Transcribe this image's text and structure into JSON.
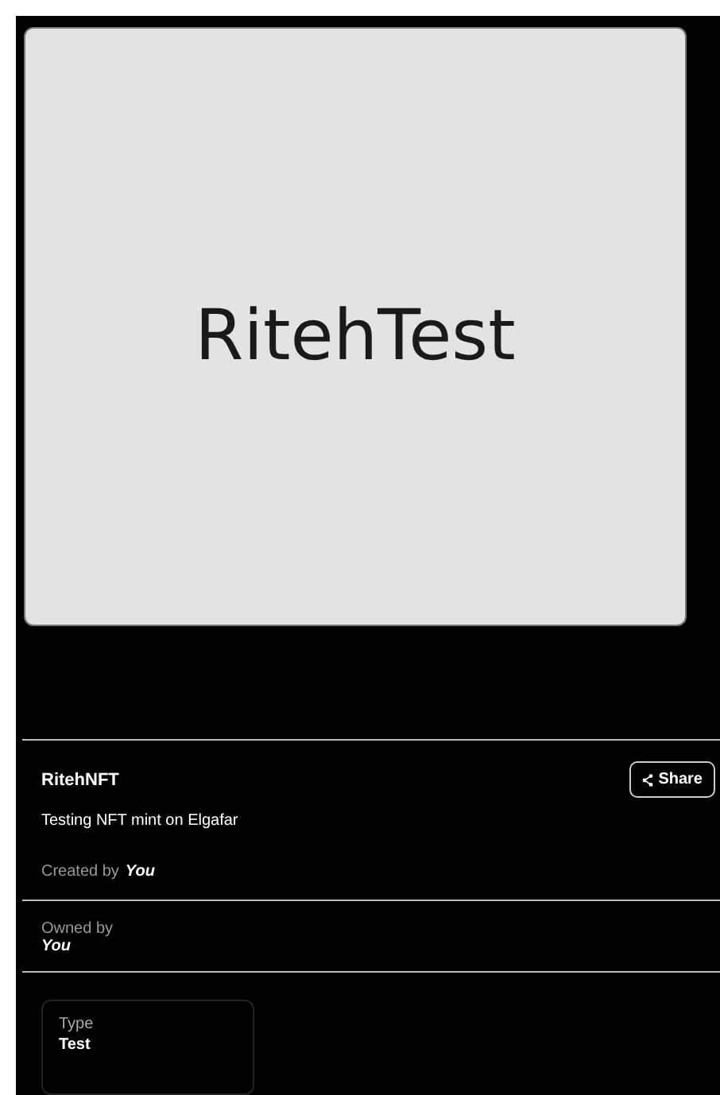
{
  "image": {
    "text": "RitehTest"
  },
  "title": "RitehNFT",
  "share_button": {
    "label": "Share"
  },
  "description": "Testing NFT mint on Elgafar",
  "created_by": {
    "label": "Created by",
    "value": "You"
  },
  "owned_by": {
    "label": "Owned by",
    "value": "You"
  },
  "attributes": [
    {
      "trait": "Type",
      "value": "Test"
    }
  ]
}
